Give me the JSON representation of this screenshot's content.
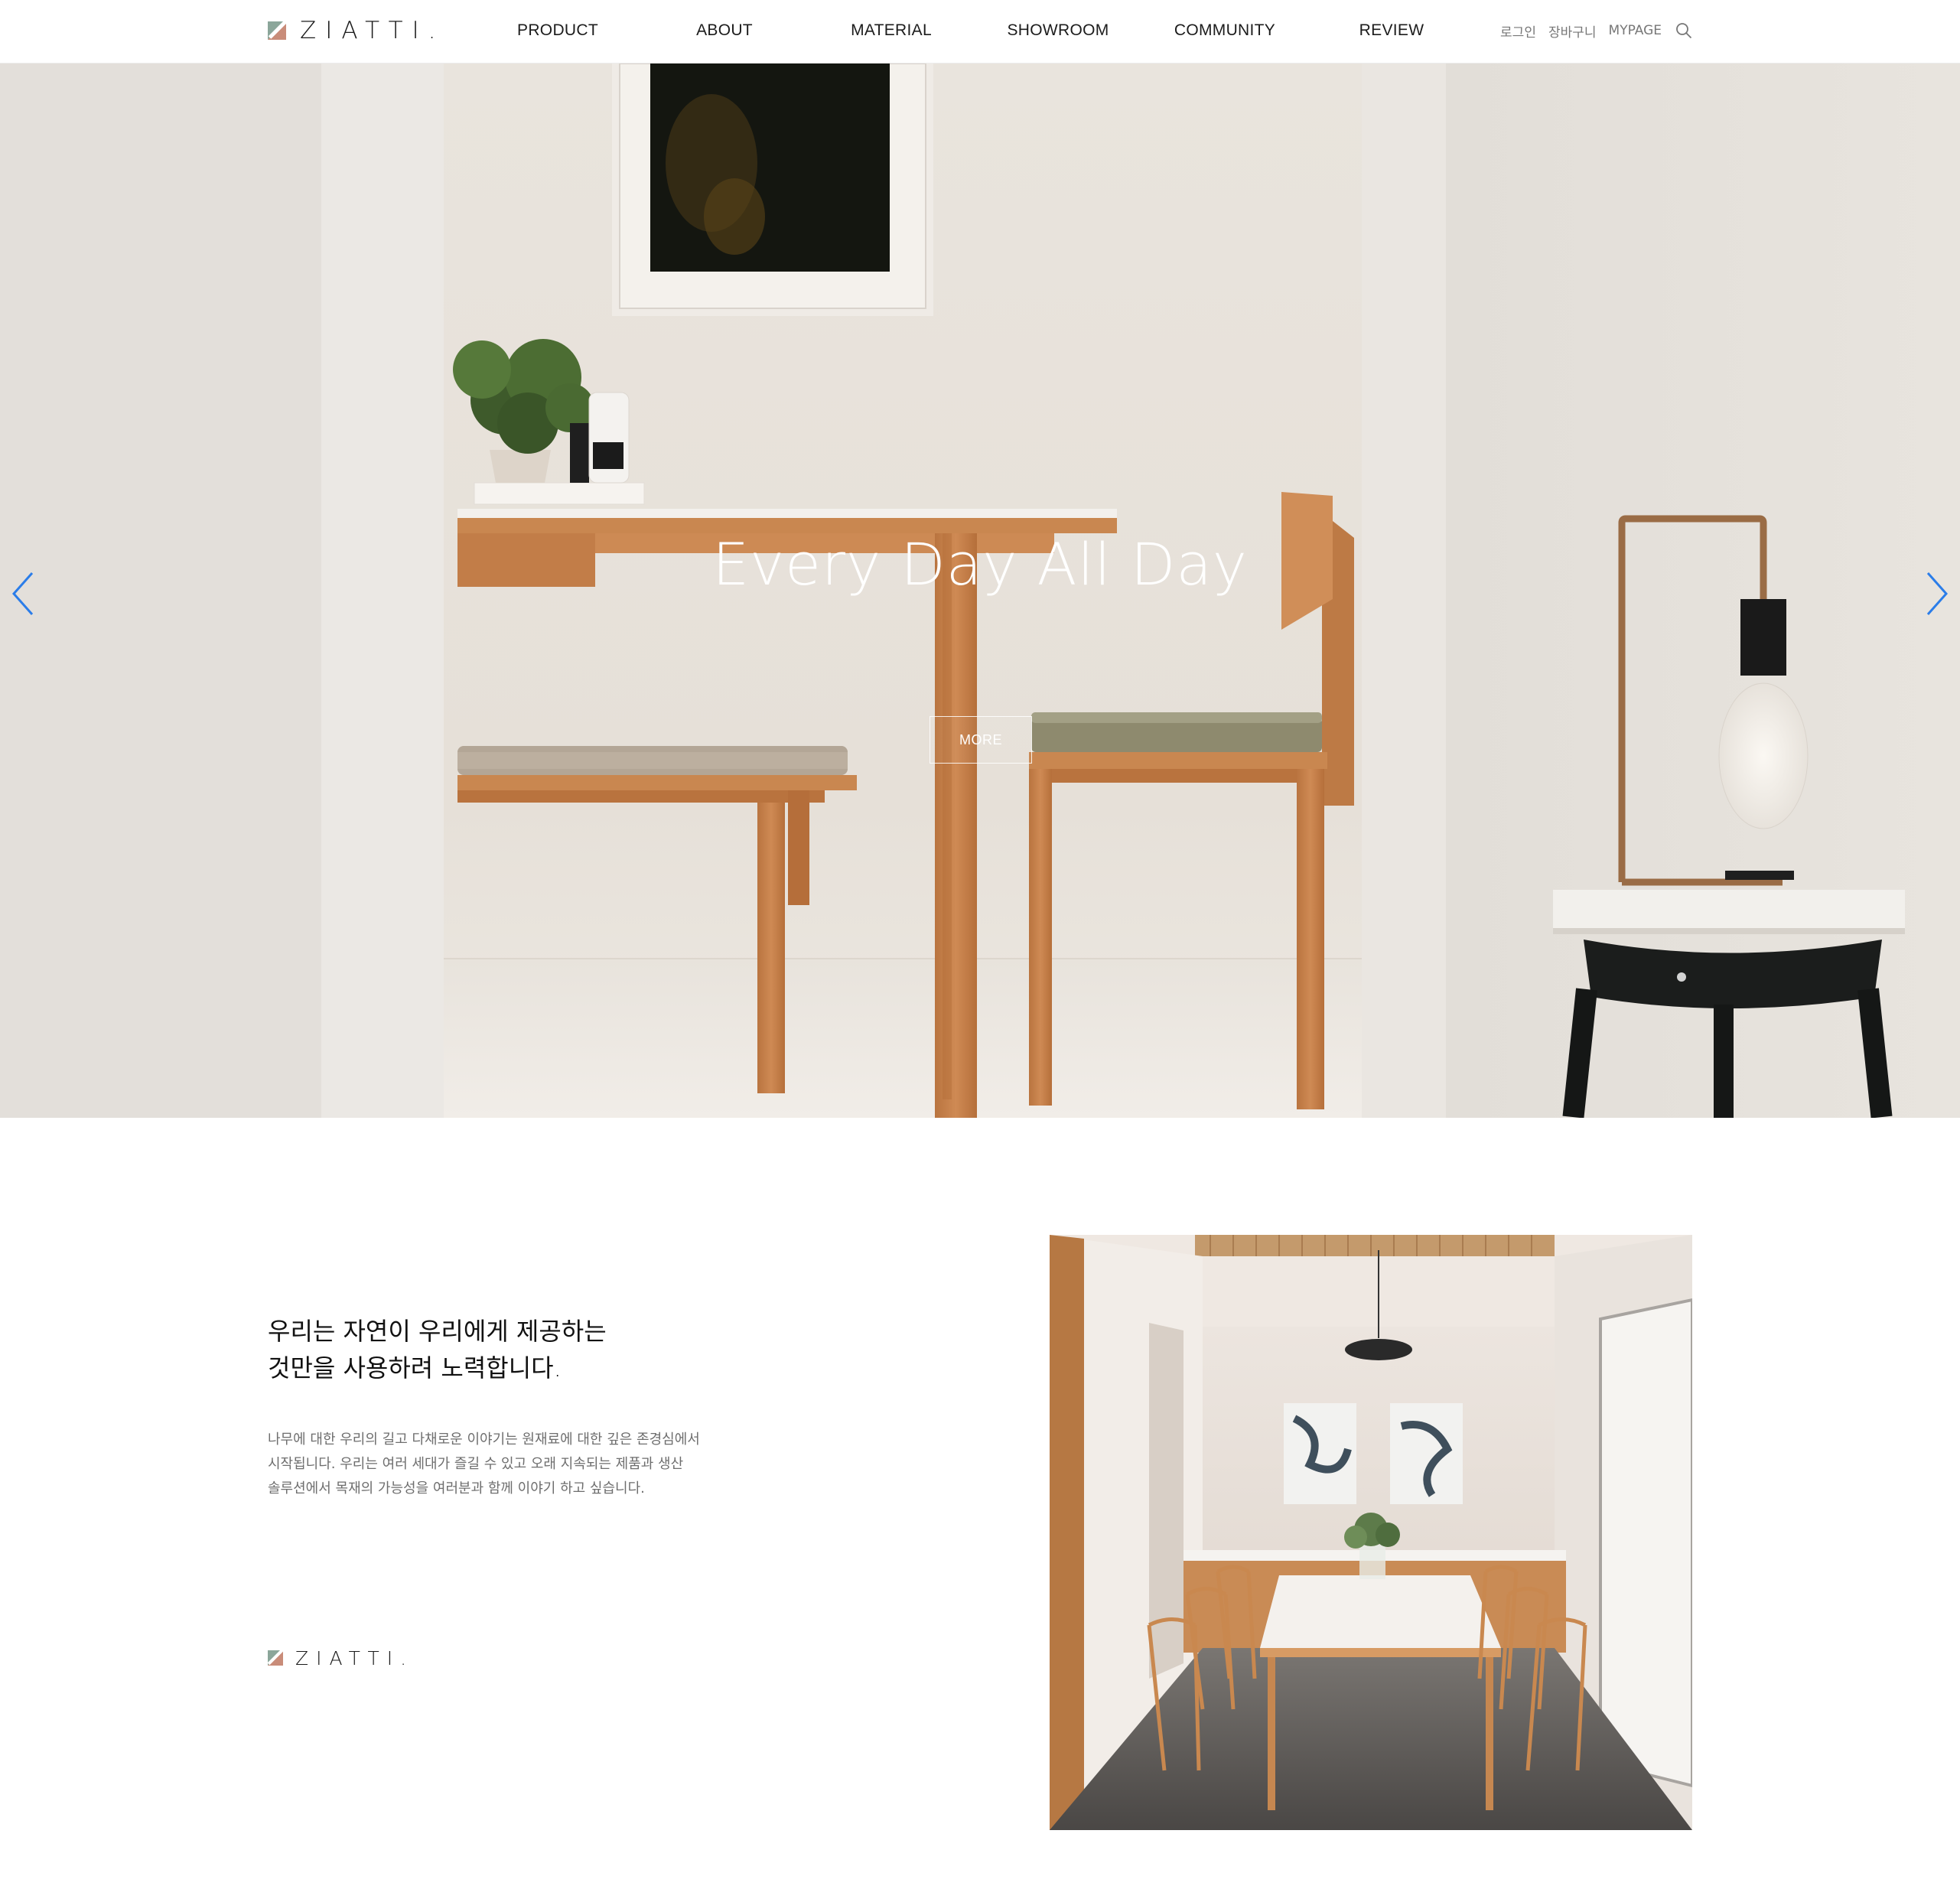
{
  "header": {
    "brand": "ZIATTI.",
    "nav": [
      "PRODUCT",
      "ABOUT",
      "MATERIAL",
      "SHOWROOM",
      "COMMUNITY",
      "REVIEW"
    ],
    "util": {
      "login": "로그인",
      "cart": "장바구니",
      "mypage": "MYPAGE"
    },
    "icons": {
      "search": "search-icon",
      "prev": "chevron-left-icon",
      "next": "chevron-right-icon"
    }
  },
  "hero": {
    "title": "Every Day All Day",
    "more_label": "MORE",
    "arrow_color": "#2b7de9"
  },
  "about": {
    "headline_line1": "우리는 자연이 우리에게 제공하는",
    "headline_line2": "것만을 사용하려 노력합니다.",
    "body_line1": "나무에 대한 우리의 길고 다채로운 이야기는 원재료에 대한 깊은 존경심에서",
    "body_line2": "시작됩니다. 우리는 여러 세대가 즐길 수 있고 오래 지속되는 제품과 생산",
    "body_line3": "솔루션에서 목재의 가능성을 여러분과 함께 이야기 하고 싶습니다.",
    "brand": "ZIATTI."
  },
  "colors": {
    "logo_green": "#8ba69a",
    "logo_coral": "#c98c79",
    "wood": "#c8844f"
  }
}
